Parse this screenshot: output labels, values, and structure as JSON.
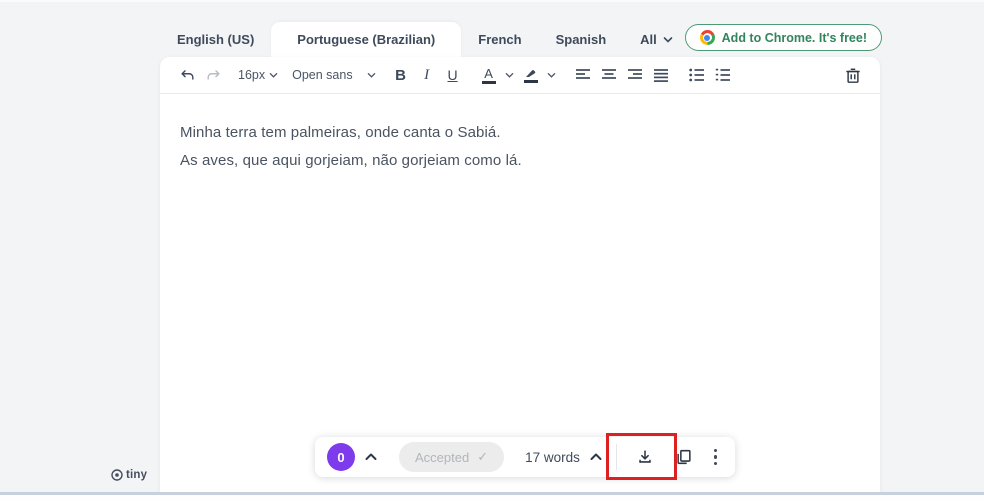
{
  "tabs": {
    "items": [
      {
        "label": "English (US)",
        "active": false
      },
      {
        "label": "Portuguese (Brazilian)",
        "active": true
      },
      {
        "label": "French",
        "active": false
      },
      {
        "label": "Spanish",
        "active": false
      },
      {
        "label": "All",
        "active": false
      }
    ]
  },
  "chrome_button": {
    "label": "Add to Chrome. It's free!"
  },
  "toolbar": {
    "font_size": "16px",
    "font_family": "Open sans",
    "bold_label": "B",
    "italic_label": "I",
    "underline_label": "U",
    "text_color_letter": "A"
  },
  "editor": {
    "lines": [
      "Minha terra tem palmeiras, onde canta o Sabiá.",
      "As aves, que aqui gorjeiam, não gorjeiam como lá."
    ]
  },
  "status_bar": {
    "counter": "0",
    "accepted_label": "Accepted",
    "word_count": "17 words"
  },
  "icons": {
    "check": "✓"
  },
  "branding": {
    "label": "tiny"
  },
  "colors": {
    "accent_purple": "#7d3bec",
    "accent_green": "#33835d",
    "annotation_red": "#dd2020"
  }
}
